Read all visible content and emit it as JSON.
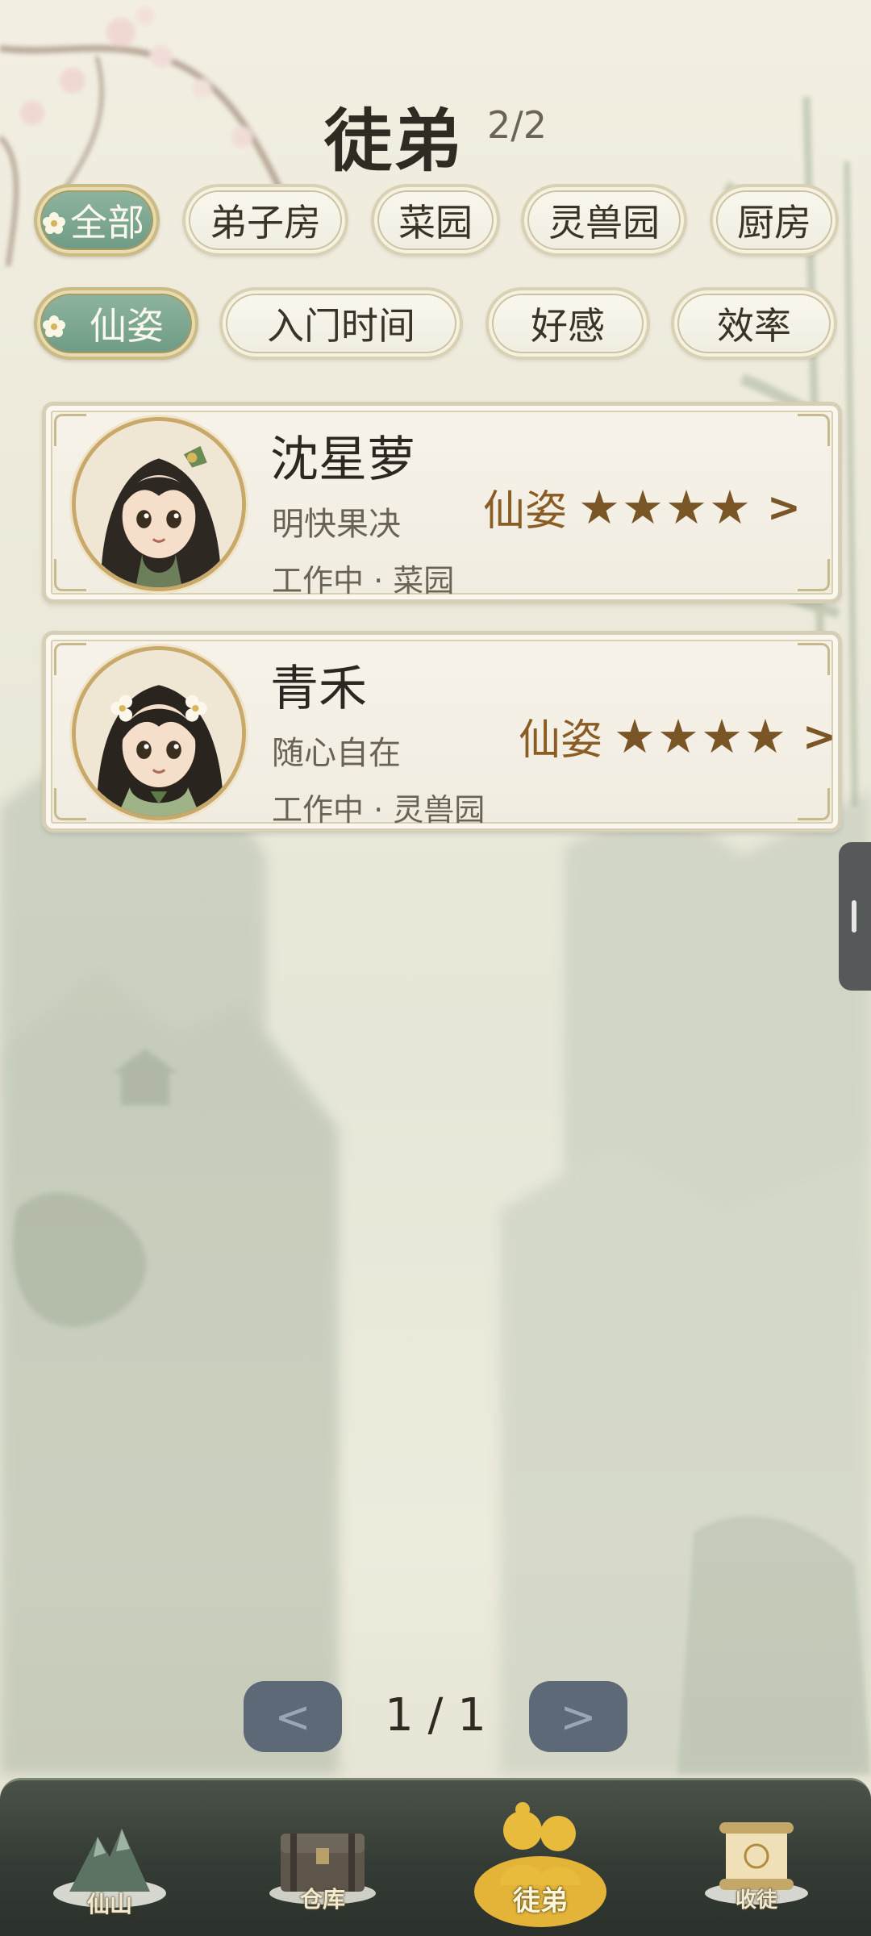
{
  "header": {
    "title": "徒弟",
    "count": "2/2"
  },
  "location_filters": [
    {
      "label": "全部",
      "active": true
    },
    {
      "label": "弟子房",
      "active": false
    },
    {
      "label": "菜园",
      "active": false
    },
    {
      "label": "灵兽园",
      "active": false
    },
    {
      "label": "厨房",
      "active": false
    }
  ],
  "sort_filters": [
    {
      "label": "仙姿",
      "active": true
    },
    {
      "label": "入门时间",
      "active": false
    },
    {
      "label": "好感",
      "active": false
    },
    {
      "label": "效率",
      "active": false
    }
  ],
  "disciples": [
    {
      "name": "沈星萝",
      "trait": "明快果决",
      "status": "工作中 · 菜园",
      "rating_label": "仙姿",
      "stars": 4,
      "star_glyphs": "★★★★",
      "chevron": ">"
    },
    {
      "name": "青禾",
      "trait": "随心自在",
      "status": "工作中 · 灵兽园",
      "rating_label": "仙姿",
      "stars": 4,
      "star_glyphs": "★★★★",
      "chevron": ">"
    }
  ],
  "pagination": {
    "prev": "<",
    "next": ">",
    "text": "1 / 1"
  },
  "bottom_nav": [
    {
      "label": "仙山",
      "icon": "mountain-icon",
      "active": false
    },
    {
      "label": "仓库",
      "icon": "chest-icon",
      "active": false
    },
    {
      "label": "徒弟",
      "icon": "disciples-icon",
      "active": true
    },
    {
      "label": "收徒",
      "icon": "scroll-icon",
      "active": false
    }
  ],
  "colors": {
    "accent_green": "#7aa58e",
    "gold": "#7a5526",
    "nav_bg": "#343b34",
    "active_gold": "#e3b437"
  }
}
